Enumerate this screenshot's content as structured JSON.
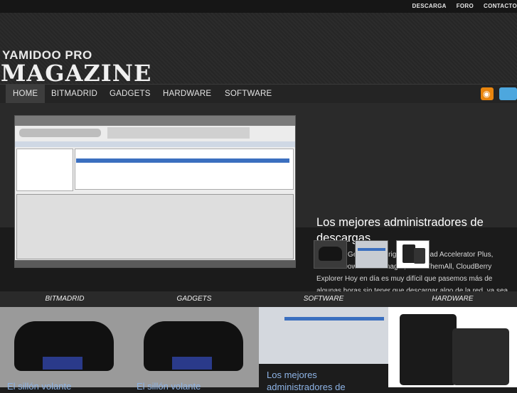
{
  "toplinks": [
    "DESCARGA",
    "FORO",
    "CONTACTO"
  ],
  "logo": {
    "line1": "YAMIDOO PRO",
    "line2": "MAGAZINE"
  },
  "nav": [
    "HOME",
    "BITMADRID",
    "GADGETS",
    "HARDWARE",
    "SOFTWARE"
  ],
  "feature": {
    "title": "Los mejores administradores de descargas",
    "text": "Flashgot, Getright, Getright, Download Accelerator Plus, Internet Download Manager, DownThemAll, CloudBerry Explorer Hoy en día es muy difícil que pasemos más de algunas horas sin tener que descargar algo de la red, ya sea desde sitios oficiales, hostings, o desde nuestros propios servidores, lo que explica la explosión de administradores de descargas que ha tenido […]"
  },
  "categories": [
    "BITMADRID",
    "GADGETS",
    "SOFTWARE",
    "HARDWARE"
  ],
  "posts": [
    "El sillón volante",
    "El sillón volante",
    "Los mejores administradores de"
  ],
  "colors": {
    "accent": "#8eb4e6",
    "rss": "#e8850e",
    "twitter": "#4da7de"
  }
}
